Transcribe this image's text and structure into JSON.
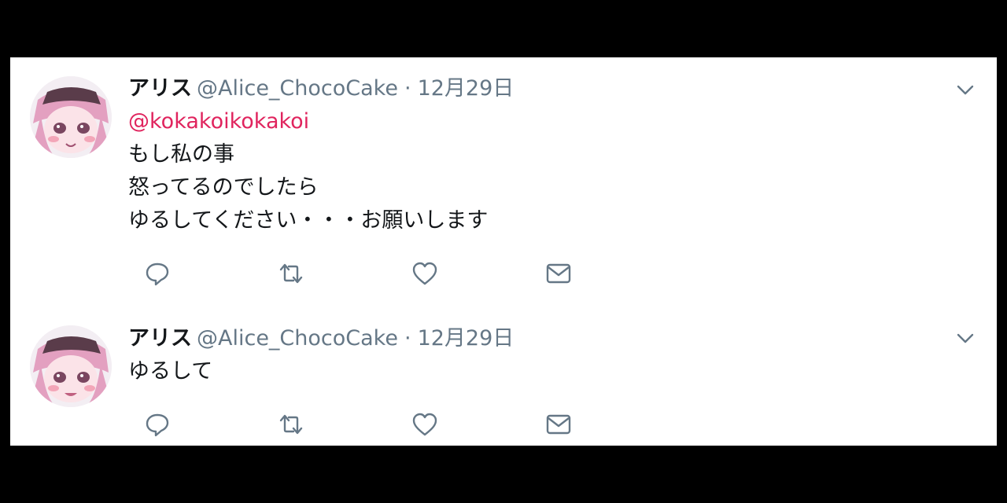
{
  "tweets": [
    {
      "author_name": "アリス",
      "handle": "@Alice_ChocoCake",
      "separator": "·",
      "date": "12月29日",
      "mention": "@kokakoikokakoi",
      "lines": [
        "もし私の事",
        "怒ってるのでしたら",
        "ゆるしてください・・・お願いします"
      ],
      "actions": [
        "reply-icon",
        "retweet-icon",
        "like-icon",
        "message-icon"
      ]
    },
    {
      "author_name": "アリス",
      "handle": "@Alice_ChocoCake",
      "separator": "·",
      "date": "12月29日",
      "lines": [
        "ゆるして"
      ],
      "actions": [
        "reply-icon",
        "retweet-icon",
        "like-icon",
        "message-icon"
      ]
    }
  ],
  "colors": {
    "text": "#14171a",
    "muted": "#657786",
    "mention": "#e0245e",
    "background": "#ffffff",
    "frame": "#000000"
  }
}
